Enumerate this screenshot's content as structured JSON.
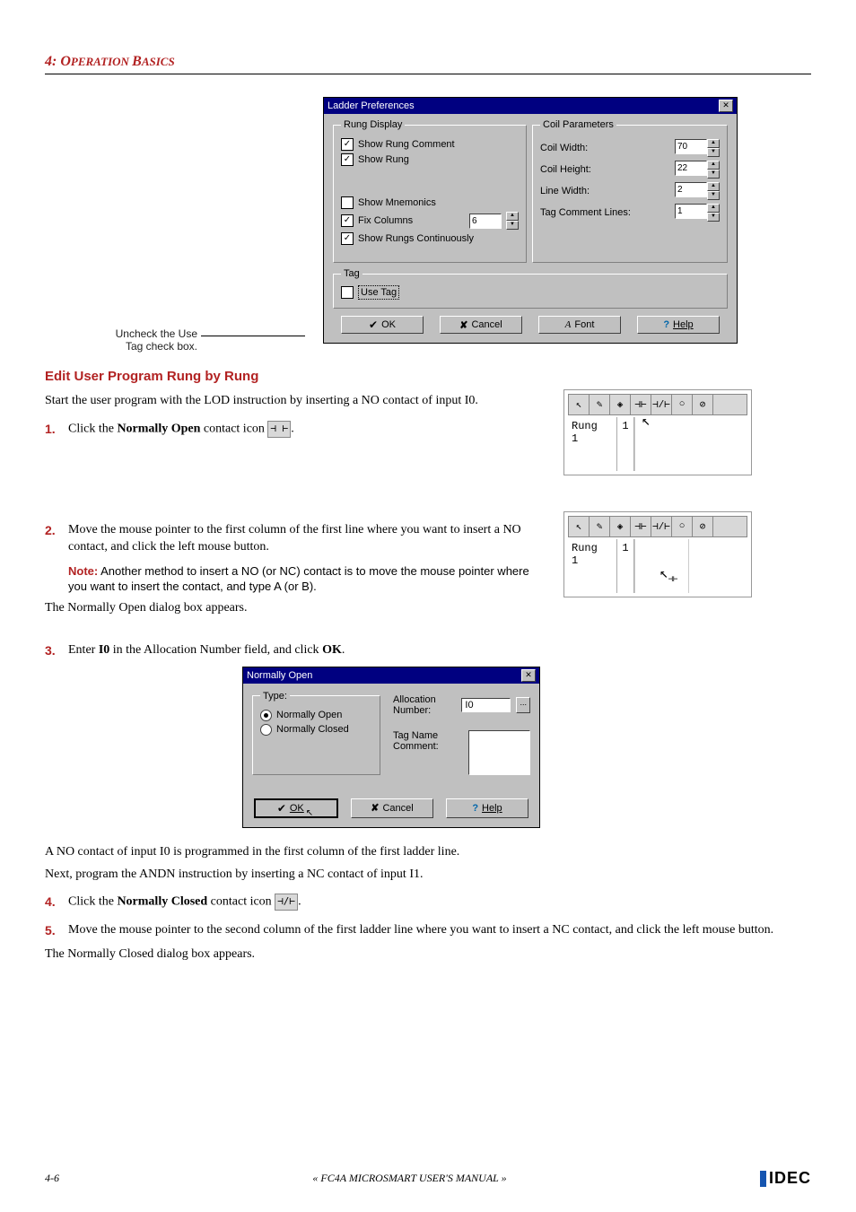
{
  "header": {
    "chapter_num": "4: ",
    "chapter_small1": "O",
    "chapter_rest1": "PERATION ",
    "chapter_small2": "B",
    "chapter_rest2": "ASICS"
  },
  "callout": {
    "line1": "Uncheck the Use",
    "line2": "Tag check box."
  },
  "ladderPrefs": {
    "title": "Ladder Preferences",
    "rungDisplay": {
      "legend": "Rung Display",
      "showRungComment": "Show Rung Comment",
      "showRung": "Show Rung",
      "showMnemonics": "Show Mnemonics",
      "fixColumns": "Fix Columns",
      "fixColumnsValue": "6",
      "showRungsContinuously": "Show Rungs Continuously"
    },
    "coilParams": {
      "legend": "Coil Parameters",
      "coilWidth": "Coil Width:",
      "coilWidthVal": "70",
      "coilHeight": "Coil Height:",
      "coilHeightVal": "22",
      "lineWidth": "Line Width:",
      "lineWidthVal": "2",
      "tagCommentLines": "Tag Comment Lines:",
      "tagCommentVal": "1"
    },
    "tag": {
      "legend": "Tag",
      "useTag": "Use Tag"
    },
    "buttons": {
      "ok": "OK",
      "cancel": "Cancel",
      "font": "Font",
      "help": "Help"
    }
  },
  "section": {
    "heading": "Edit User Program Rung by Rung",
    "intro": "Start the user program with the LOD instruction by inserting a NO contact of input I0.",
    "step1_a": "Click the ",
    "step1_b": "Normally Open",
    "step1_c": " contact icon ",
    "step1_d": ".",
    "step2": "Move the mouse pointer to the first column of the first line where you want to insert a NO contact, and click the left mouse button.",
    "note_label": "Note:",
    "note_text": " Another method to insert a NO (or NC) contact is to move the mouse pointer where you want to insert the contact, and type A (or B).",
    "afterStep2": "The Normally Open dialog box appears.",
    "step3_a": "Enter ",
    "step3_b": "I0",
    "step3_c": " in the Allocation Number field, and click ",
    "step3_d": "OK",
    "step3_e": ".",
    "afterDialog1": "A NO contact of input I0 is programmed in the first column of the first ladder line.",
    "afterDialog2": "Next, program the ANDN instruction by inserting a NC contact of input I1.",
    "step4_a": "Click the ",
    "step4_b": "Normally Closed",
    "step4_c": " contact icon ",
    "step4_d": ".",
    "step5": "Move the mouse pointer to the second column of the first ladder line where you want to insert a NC contact, and click the left mouse button.",
    "afterStep5": "The Normally Closed dialog box appears."
  },
  "rung": {
    "label1": "Rung",
    "label2": " 1",
    "num": "1"
  },
  "noDialog": {
    "title": "Normally Open",
    "typeLegend": "Type:",
    "normallyOpen": "Normally Open",
    "normallyClosed": "Normally Closed",
    "allocLabel": "Allocation Number:",
    "allocVal": "I0",
    "tagNameLabel": "Tag Name Comment:",
    "ok": "OK",
    "cancel": "Cancel",
    "help": "Help"
  },
  "footer": {
    "pageNum": "4-6",
    "center": "« FC4A MICROSMART USER'S MANUAL »",
    "brand": "IDEC"
  },
  "icons": {
    "noContact": "⊣ ⊢",
    "ncContact": "⊣/⊢"
  }
}
